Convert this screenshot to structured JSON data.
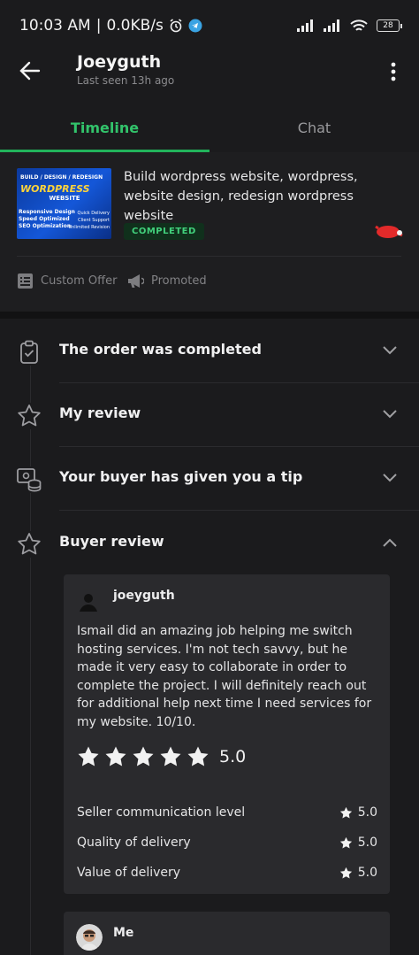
{
  "status_bar": {
    "time": "10:03 AM",
    "speed": "0.0KB/s",
    "battery": "28"
  },
  "header": {
    "name": "Joeyguth",
    "last_seen": "Last seen 13h ago"
  },
  "tabs": [
    {
      "label": "Timeline",
      "active": true
    },
    {
      "label": "Chat",
      "active": false
    }
  ],
  "order": {
    "thumbnail": {
      "line1": "BUILD / DESIGN / REDESIGN",
      "line2": "WORDPRESS",
      "line3": "WEBSITE",
      "left_lines": [
        "Responsive Design",
        "Speed Optimized",
        "SEO Optimization"
      ],
      "right_lines": [
        "Quick Delivery",
        "Client Support",
        "Unlimited Revision"
      ]
    },
    "title": "Build wordpress website, wordpress, website design, redesign wordpress website",
    "status": "COMPLETED",
    "custom_offer": "Custom Offer",
    "promoted": "Promoted"
  },
  "timeline": [
    {
      "label": "The order was completed",
      "icon": "clipboard-check-icon",
      "expanded": false
    },
    {
      "label": "My review",
      "icon": "star-outline-icon",
      "expanded": false
    },
    {
      "label": "Your buyer has given you a tip",
      "icon": "tip-coins-icon",
      "expanded": false
    },
    {
      "label": "Buyer review",
      "icon": "star-outline-icon",
      "expanded": true
    }
  ],
  "buyer_review": {
    "reviewer": "joeyguth",
    "text": "Ismail did an amazing job helping me switch hosting services. I'm not tech savvy, but he made it very easy to collaborate in order to complete the project. I will definitely reach out for additional help next time I need services for my website. 10/10.",
    "rating": "5.0",
    "stars": 5,
    "criteria": [
      {
        "label": "Seller communication level",
        "value": "5.0"
      },
      {
        "label": "Quality of delivery",
        "value": "5.0"
      },
      {
        "label": "Value of delivery",
        "value": "5.0"
      }
    ]
  },
  "my_reply": {
    "name": "Me"
  },
  "colors": {
    "accent_green": "#22b35b",
    "background": "#1b1b1d",
    "card": "#2a2a2d"
  }
}
